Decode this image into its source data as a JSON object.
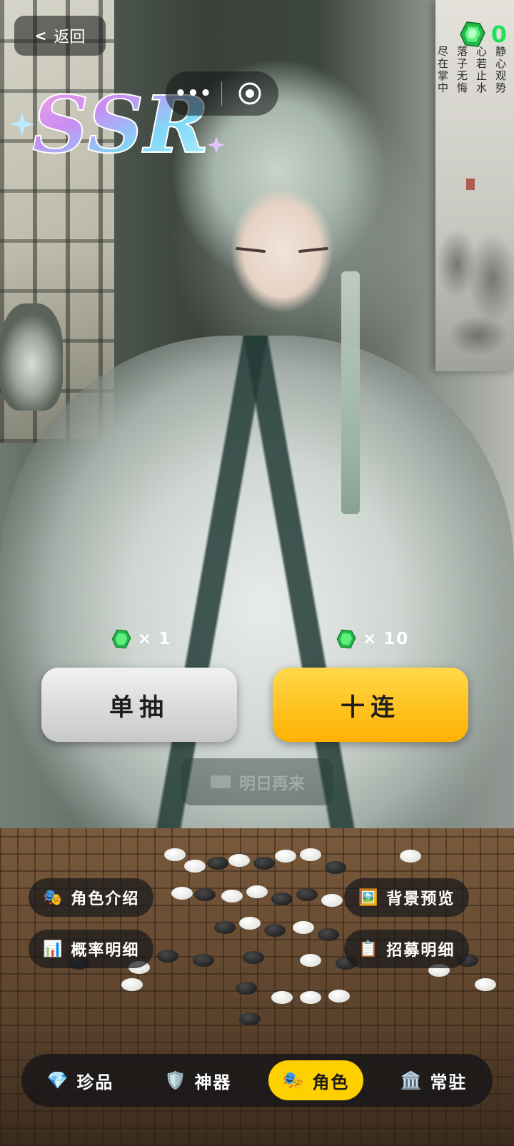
{
  "header": {
    "back_label": "返回",
    "back_chevron": "<",
    "rarity_label": "SSR",
    "capsule_more": "•••",
    "gem_count": "0"
  },
  "artwork": {
    "poem_lines": [
      "静心观势",
      "心若止水",
      "落子无悔",
      "尽在掌中"
    ]
  },
  "draw": {
    "single": {
      "cost_prefix": "×",
      "cost_value": "1",
      "label": "单抽"
    },
    "ten": {
      "cost_prefix": "×",
      "cost_value": "10",
      "label": "十连"
    },
    "tomorrow_label": "明日再来"
  },
  "actions": {
    "character_intro": "角色介绍",
    "probability_detail": "概率明细",
    "background_preview": "背景预览",
    "recruit_detail": "招募明细",
    "character_intro_icon": "🎭",
    "probability_detail_icon": "📊",
    "background_preview_icon": "🖼️",
    "recruit_detail_icon": "📋"
  },
  "nav": {
    "items": [
      {
        "label": "珍品",
        "icon": "💎",
        "icon_name": "gem-icon"
      },
      {
        "label": "神器",
        "icon": "🛡️",
        "icon_name": "shield-icon"
      },
      {
        "label": "角色",
        "icon": "🎭",
        "icon_name": "mask-icon"
      },
      {
        "label": "常驻",
        "icon": "🏛️",
        "icon_name": "temple-icon"
      }
    ],
    "active_index": 2
  },
  "colors": {
    "gem_green": "#22e05a",
    "ten_button": "#ffb000",
    "nav_active": "#ffd000"
  }
}
